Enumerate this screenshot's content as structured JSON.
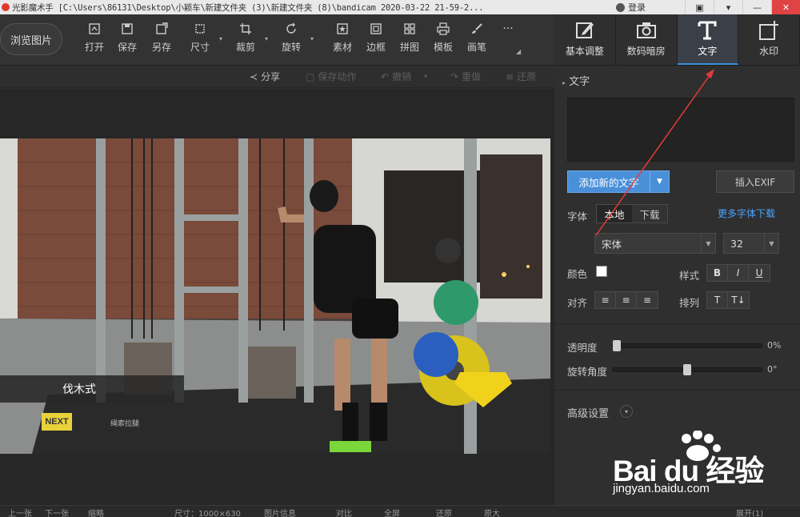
{
  "titlebar": {
    "text": "光影魔术手  [C:\\Users\\86131\\Desktop\\小颖车\\新建文件夹 (3)\\新建文件夹 (8)\\bandicam 2020-03-22 21-59-2...",
    "login": "登录"
  },
  "toolbar": {
    "browse": "浏览图片",
    "items": [
      {
        "label": "打开"
      },
      {
        "label": "保存"
      },
      {
        "label": "另存"
      },
      {
        "label": "尺寸"
      },
      {
        "label": "裁剪"
      },
      {
        "label": "旋转"
      },
      {
        "label": "素材"
      },
      {
        "label": "边框"
      },
      {
        "label": "拼图"
      },
      {
        "label": "模板"
      },
      {
        "label": "画笔"
      }
    ]
  },
  "rtabs": [
    {
      "label": "基本调整"
    },
    {
      "label": "数码暗房"
    },
    {
      "label": "文字"
    },
    {
      "label": "水印"
    }
  ],
  "subbar": {
    "share": "分享",
    "save_action": "保存动作",
    "undo": "撤销",
    "redo": "重做",
    "restore": "还原"
  },
  "photo": {
    "caption": "伐木式",
    "next": "NEXT",
    "sub": "绳索拉腿"
  },
  "panel": {
    "title": "文字",
    "add_text": "添加新的文字",
    "insert_exif": "插入EXIF",
    "font_label": "字体",
    "font_tab_local": "本地",
    "font_tab_download": "下载",
    "more_fonts": "更多字体下载",
    "font_name": "宋体",
    "font_size": "32",
    "color_label": "颜色",
    "style_label": "样式",
    "style_bold": "B",
    "style_italic": "I",
    "style_underline": "U",
    "align_label": "对齐",
    "arrange_label": "排列",
    "opacity_label": "透明度",
    "opacity_value": "0%",
    "opacity": 0,
    "rotate_label": "旋转角度",
    "rotate_value": "0°",
    "rotate": 0.5,
    "advanced_label": "高级设置"
  },
  "status": {
    "a": "上一张",
    "b": "下一张",
    "c": "缩略",
    "d": "尺寸：1000×630",
    "e": "图片信息",
    "f": "对比",
    "g": "全屏",
    "h": "还原",
    "i": "原大",
    "j": "展开(1)"
  },
  "watermark": {
    "brand": "Bai du 经验",
    "url": "jingyan.baidu.com"
  },
  "colors": {
    "accent": "#4a90d9",
    "link": "#4aa3ff",
    "annotation": "#e23b3b"
  }
}
